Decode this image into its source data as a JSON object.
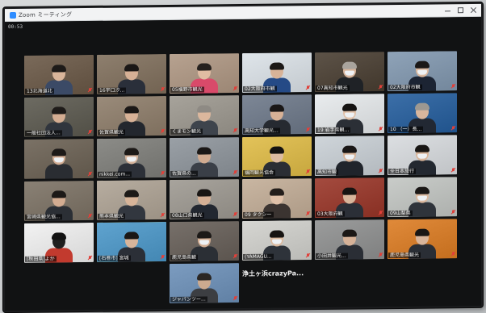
{
  "window": {
    "title": "Zoom ミーティング",
    "timer": "00:53"
  },
  "tiles": [
    {
      "label": "13北海道北",
      "bg": "#7a6a5a",
      "shirt": "#3b4a66",
      "skin": "#d9b59a",
      "hair": "#1d1a18",
      "mask": false,
      "muted": true
    },
    {
      "label": "16宇口汐...",
      "bg": "#8e7f6e",
      "shirt": "#2a2f3a",
      "skin": "#d6b095",
      "hair": "#1a1716",
      "mask": false,
      "muted": true
    },
    {
      "label": "05福野市観光",
      "bg": "#b7a290",
      "shirt": "#d94a6a",
      "skin": "#e0bca3",
      "hair": "#26211e",
      "mask": false,
      "muted": true
    },
    {
      "label": "02大阪府市観",
      "bg": "#dfe5ea",
      "shirt": "#254a86",
      "skin": "#d8b398",
      "hair": "#1b1816",
      "mask": false,
      "muted": true
    },
    {
      "label": "07高知市観光",
      "bg": "#5d5348",
      "shirt": "#1f2226",
      "skin": "#d7b49b",
      "hair": "#a9a49d",
      "mask": true,
      "muted": true
    },
    {
      "label": "02大阪府市観",
      "bg": "#8fa3b8",
      "shirt": "#1c2433",
      "skin": "#dab89f",
      "hair": "#1b1817",
      "mask": true,
      "muted": true
    },
    {
      "label": "一般社団法人...",
      "bg": "#6d6b62",
      "shirt": "#30353d",
      "skin": "#d4ad92",
      "hair": "#1e1b19",
      "mask": false,
      "muted": true
    },
    {
      "label": "佐賀県観光",
      "bg": "#9a8b7a",
      "shirt": "#23272e",
      "skin": "#d8b297",
      "hair": "#1b1817",
      "mask": false,
      "muted": true
    },
    {
      "label": "くまモン観光",
      "bg": "#a7a39b",
      "shirt": "#3e444c",
      "skin": "#dbb79d",
      "hair": "#8e8a84",
      "mask": false,
      "muted": true
    },
    {
      "label": "高知大学観光...",
      "bg": "#7d8796",
      "shirt": "#262a31",
      "skin": "#d7b196",
      "hair": "#1a1716",
      "mask": false,
      "muted": true
    },
    {
      "label": "19 岩手県観...",
      "bg": "#e9ecee",
      "shirt": "#2b2f36",
      "skin": "#e0c1a9",
      "hair": "#151312",
      "mask": true,
      "muted": true
    },
    {
      "label": "10 （一）長...",
      "bg": "#3c6fa8",
      "shirt": "#222833",
      "skin": "#d9b69d",
      "hair": "#9d9891",
      "mask": false,
      "muted": true
    },
    {
      "label": "",
      "bg": "#7b7266",
      "shirt": "#2a2d32",
      "skin": "#d4ae94",
      "hair": "#1d1a18",
      "mask": true,
      "muted": true
    },
    {
      "label": "nikkei.com...",
      "bg": "#8c8c88",
      "shirt": "#2c3038",
      "skin": "#d6b49c",
      "hair": "#1c1917",
      "mask": true,
      "muted": true
    },
    {
      "label": "佐賀県の...",
      "bg": "#9aa0a6",
      "shirt": "#3a3f47",
      "skin": "#d1ab90",
      "hair": "#1b1816",
      "mask": false,
      "muted": true
    },
    {
      "label": "福岡観光協会",
      "bg": "#e3c35a",
      "shirt": "#2b2e34",
      "skin": "#dcbba2",
      "hair": "#141211",
      "mask": false,
      "muted": true
    },
    {
      "label": "高知市観",
      "bg": "#cfd5da",
      "shirt": "#20242b",
      "skin": "#d7b398",
      "hair": "#1a1716",
      "mask": true,
      "muted": true
    },
    {
      "label": "全日本旅行",
      "bg": "#dcdfe2",
      "shirt": "#232830",
      "skin": "#d8b59b",
      "hair": "#181614",
      "mask": true,
      "muted": true
    },
    {
      "label": "宮崎県観光協...",
      "bg": "#8a8175",
      "shirt": "#2b2f35",
      "skin": "#d3ac91",
      "hair": "#1c1917",
      "mask": false,
      "muted": true
    },
    {
      "label": "熊本県観光",
      "bg": "#b7ada0",
      "shirt": "#32373f",
      "skin": "#d7b499",
      "hair": "#1d1a18",
      "mask": false,
      "muted": true
    },
    {
      "label": "08山口県観光",
      "bg": "#a8a49d",
      "shirt": "#222730",
      "skin": "#d5b095",
      "hair": "#191614",
      "mask": false,
      "muted": true
    },
    {
      "label": "09 タクシー",
      "bg": "#c9b6a2",
      "shirt": "#3b3431",
      "skin": "#dfc0a8",
      "hair": "#241e1b",
      "mask": false,
      "muted": true
    },
    {
      "label": "03大阪府観",
      "bg": "#a44b3f",
      "shirt": "#2b2f37",
      "skin": "#d8b69c",
      "hair": "#171412",
      "mask": false,
      "muted": true
    },
    {
      "label": "09山梨県",
      "bg": "#c9ccc9",
      "shirt": "#2f343b",
      "skin": "#dbb99f",
      "hair": "#1a1716",
      "mask": true,
      "muted": true
    },
    {
      "label": "[秋田県]よか",
      "bg": "#f2f2f2",
      "shirt": "#c23a2e",
      "skin": "#1f1f1f",
      "hair": "#111111",
      "mask": false,
      "muted": true
    },
    {
      "label": "[石巻市] 宮城",
      "bg": "#5fa3cf",
      "shirt": "#2b2f37",
      "skin": "#d8b59b",
      "hair": "#1a1716",
      "mask": false,
      "muted": true,
      "active": true
    },
    {
      "label": "鹿児島県観",
      "bg": "#77706a",
      "shirt": "#2b2f35",
      "skin": "#d4af94",
      "hair": "#1c1917",
      "mask": true,
      "muted": true
    },
    {
      "label": "(YAMAGU...",
      "bg": "#d6d6d2",
      "shirt": "#2e333a",
      "skin": "#dbba9f",
      "hair": "#171412",
      "mask": true,
      "muted": true
    },
    {
      "label": "小田井観光...",
      "bg": "#9b9c9c",
      "shirt": "#2a2e35",
      "skin": "#d6b298",
      "hair": "#1b1816",
      "mask": false,
      "muted": true
    },
    {
      "label": "鹿児島県観光",
      "bg": "#e08a3a",
      "shirt": "#2a2e35",
      "skin": "#d8b59b",
      "hair": "#191614",
      "mask": false,
      "muted": true
    },
    {
      "label": "ジャパンツー...",
      "bg": "#7c9cc0",
      "shirt": "#3c3e42",
      "skin": "#ccaa8f",
      "hair": "#2a2623",
      "mask": false,
      "muted": true
    }
  ],
  "banner": "浄土ヶ浜crazyPa..."
}
